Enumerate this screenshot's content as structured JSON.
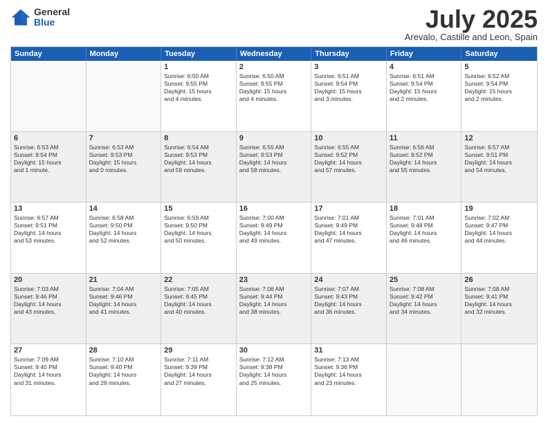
{
  "header": {
    "logo_general": "General",
    "logo_blue": "Blue",
    "month": "July 2025",
    "location": "Arevalo, Castille and Leon, Spain"
  },
  "days_of_week": [
    "Sunday",
    "Monday",
    "Tuesday",
    "Wednesday",
    "Thursday",
    "Friday",
    "Saturday"
  ],
  "weeks": [
    [
      {
        "day": "",
        "info": [],
        "empty": true
      },
      {
        "day": "",
        "info": [],
        "empty": true
      },
      {
        "day": "1",
        "info": [
          "Sunrise: 6:50 AM",
          "Sunset: 9:55 PM",
          "Daylight: 15 hours",
          "and 4 minutes."
        ]
      },
      {
        "day": "2",
        "info": [
          "Sunrise: 6:50 AM",
          "Sunset: 9:55 PM",
          "Daylight: 15 hours",
          "and 4 minutes."
        ]
      },
      {
        "day": "3",
        "info": [
          "Sunrise: 6:51 AM",
          "Sunset: 9:54 PM",
          "Daylight: 15 hours",
          "and 3 minutes."
        ]
      },
      {
        "day": "4",
        "info": [
          "Sunrise: 6:51 AM",
          "Sunset: 9:54 PM",
          "Daylight: 15 hours",
          "and 2 minutes."
        ]
      },
      {
        "day": "5",
        "info": [
          "Sunrise: 6:52 AM",
          "Sunset: 9:54 PM",
          "Daylight: 15 hours",
          "and 2 minutes."
        ]
      }
    ],
    [
      {
        "day": "6",
        "info": [
          "Sunrise: 6:53 AM",
          "Sunset: 9:54 PM",
          "Daylight: 15 hours",
          "and 1 minute."
        ],
        "alt": true
      },
      {
        "day": "7",
        "info": [
          "Sunrise: 6:53 AM",
          "Sunset: 9:53 PM",
          "Daylight: 15 hours",
          "and 0 minutes."
        ],
        "alt": true
      },
      {
        "day": "8",
        "info": [
          "Sunrise: 6:54 AM",
          "Sunset: 9:53 PM",
          "Daylight: 14 hours",
          "and 59 minutes."
        ],
        "alt": true
      },
      {
        "day": "9",
        "info": [
          "Sunrise: 6:55 AM",
          "Sunset: 9:53 PM",
          "Daylight: 14 hours",
          "and 58 minutes."
        ],
        "alt": true
      },
      {
        "day": "10",
        "info": [
          "Sunrise: 6:55 AM",
          "Sunset: 9:52 PM",
          "Daylight: 14 hours",
          "and 57 minutes."
        ],
        "alt": true
      },
      {
        "day": "11",
        "info": [
          "Sunrise: 6:56 AM",
          "Sunset: 9:52 PM",
          "Daylight: 14 hours",
          "and 55 minutes."
        ],
        "alt": true
      },
      {
        "day": "12",
        "info": [
          "Sunrise: 6:57 AM",
          "Sunset: 9:51 PM",
          "Daylight: 14 hours",
          "and 54 minutes."
        ],
        "alt": true
      }
    ],
    [
      {
        "day": "13",
        "info": [
          "Sunrise: 6:57 AM",
          "Sunset: 9:51 PM",
          "Daylight: 14 hours",
          "and 53 minutes."
        ]
      },
      {
        "day": "14",
        "info": [
          "Sunrise: 6:58 AM",
          "Sunset: 9:50 PM",
          "Daylight: 14 hours",
          "and 52 minutes."
        ]
      },
      {
        "day": "15",
        "info": [
          "Sunrise: 6:59 AM",
          "Sunset: 9:50 PM",
          "Daylight: 14 hours",
          "and 50 minutes."
        ]
      },
      {
        "day": "16",
        "info": [
          "Sunrise: 7:00 AM",
          "Sunset: 9:49 PM",
          "Daylight: 14 hours",
          "and 49 minutes."
        ]
      },
      {
        "day": "17",
        "info": [
          "Sunrise: 7:01 AM",
          "Sunset: 9:49 PM",
          "Daylight: 14 hours",
          "and 47 minutes."
        ]
      },
      {
        "day": "18",
        "info": [
          "Sunrise: 7:01 AM",
          "Sunset: 9:48 PM",
          "Daylight: 14 hours",
          "and 46 minutes."
        ]
      },
      {
        "day": "19",
        "info": [
          "Sunrise: 7:02 AM",
          "Sunset: 9:47 PM",
          "Daylight: 14 hours",
          "and 44 minutes."
        ]
      }
    ],
    [
      {
        "day": "20",
        "info": [
          "Sunrise: 7:03 AM",
          "Sunset: 9:46 PM",
          "Daylight: 14 hours",
          "and 43 minutes."
        ],
        "alt": true
      },
      {
        "day": "21",
        "info": [
          "Sunrise: 7:04 AM",
          "Sunset: 9:46 PM",
          "Daylight: 14 hours",
          "and 41 minutes."
        ],
        "alt": true
      },
      {
        "day": "22",
        "info": [
          "Sunrise: 7:05 AM",
          "Sunset: 9:45 PM",
          "Daylight: 14 hours",
          "and 40 minutes."
        ],
        "alt": true
      },
      {
        "day": "23",
        "info": [
          "Sunrise: 7:06 AM",
          "Sunset: 9:44 PM",
          "Daylight: 14 hours",
          "and 38 minutes."
        ],
        "alt": true
      },
      {
        "day": "24",
        "info": [
          "Sunrise: 7:07 AM",
          "Sunset: 9:43 PM",
          "Daylight: 14 hours",
          "and 36 minutes."
        ],
        "alt": true
      },
      {
        "day": "25",
        "info": [
          "Sunrise: 7:08 AM",
          "Sunset: 9:42 PM",
          "Daylight: 14 hours",
          "and 34 minutes."
        ],
        "alt": true
      },
      {
        "day": "26",
        "info": [
          "Sunrise: 7:08 AM",
          "Sunset: 9:41 PM",
          "Daylight: 14 hours",
          "and 32 minutes."
        ],
        "alt": true
      }
    ],
    [
      {
        "day": "27",
        "info": [
          "Sunrise: 7:09 AM",
          "Sunset: 9:40 PM",
          "Daylight: 14 hours",
          "and 31 minutes."
        ]
      },
      {
        "day": "28",
        "info": [
          "Sunrise: 7:10 AM",
          "Sunset: 9:40 PM",
          "Daylight: 14 hours",
          "and 29 minutes."
        ]
      },
      {
        "day": "29",
        "info": [
          "Sunrise: 7:11 AM",
          "Sunset: 9:39 PM",
          "Daylight: 14 hours",
          "and 27 minutes."
        ]
      },
      {
        "day": "30",
        "info": [
          "Sunrise: 7:12 AM",
          "Sunset: 9:38 PM",
          "Daylight: 14 hours",
          "and 25 minutes."
        ]
      },
      {
        "day": "31",
        "info": [
          "Sunrise: 7:13 AM",
          "Sunset: 9:36 PM",
          "Daylight: 14 hours",
          "and 23 minutes."
        ]
      },
      {
        "day": "",
        "info": [],
        "empty": true
      },
      {
        "day": "",
        "info": [],
        "empty": true
      }
    ]
  ]
}
